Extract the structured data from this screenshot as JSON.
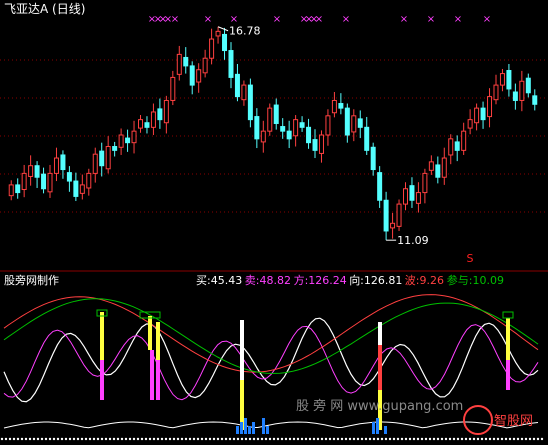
{
  "upper": {
    "title": "飞亚达A (日线)",
    "high_label": "16.78",
    "low_label": "11.09",
    "s_marker": "S",
    "x_marker": "×",
    "colors": {
      "up": "#ff4040",
      "down": "#54ffff",
      "title": "#ffffff",
      "marker": "#ff40ff",
      "grid": "#8a0000",
      "s_marker": "#ff2020"
    }
  },
  "lower": {
    "indicator_name": "股旁网制作",
    "readouts": [
      {
        "label": "买",
        "value": "45.43",
        "color": "#ffffff"
      },
      {
        "label": "卖",
        "value": "48.82",
        "color": "#ff40ff"
      },
      {
        "label": "方",
        "value": "126.24",
        "color": "#ff40ff"
      },
      {
        "label": "向",
        "value": "126.81",
        "color": "#ffffff"
      },
      {
        "label": "波",
        "value": "9.26",
        "color": "#ff4040"
      },
      {
        "label": "参与",
        "value": "10.09",
        "color": "#00c000"
      }
    ],
    "colors": {
      "white": "#ffffff",
      "magenta": "#ff40ff",
      "red": "#ff4040",
      "green": "#00c000",
      "yellow": "#ffff40",
      "blue": "#2080ff",
      "divider": "#8a0000"
    }
  },
  "watermark": {
    "text": "股 旁 网   www.gupang.com",
    "logo_text": "智股网"
  },
  "chart_data": [
    {
      "type": "candlestick",
      "title": "飞亚达A (日线)",
      "annotations": [
        {
          "text": "16.78",
          "kind": "period-high"
        },
        {
          "text": "11.09",
          "kind": "period-low"
        }
      ],
      "close_series_approx": [
        12.6,
        12.4,
        12.9,
        13.1,
        12.8,
        12.5,
        12.9,
        13.3,
        13.0,
        12.7,
        12.3,
        12.6,
        12.9,
        13.4,
        13.1,
        13.6,
        13.5,
        13.9,
        13.7,
        14.0,
        14.3,
        14.1,
        14.5,
        14.3,
        14.8,
        15.4,
        16.0,
        15.7,
        15.2,
        15.6,
        15.9,
        16.4,
        16.6,
        16.1,
        15.4,
        14.9,
        15.2,
        14.3,
        13.8,
        14.0,
        14.6,
        14.2,
        14.0,
        13.8,
        14.3,
        14.1,
        13.7,
        13.5,
        13.9,
        14.4,
        14.8,
        14.6,
        13.9,
        14.4,
        14.1,
        13.5,
        13.0,
        12.2,
        11.4,
        11.6,
        12.1,
        12.5,
        12.2,
        12.4,
        12.9,
        13.2,
        12.8,
        13.3,
        13.8,
        13.5,
        14.0,
        14.3,
        14.6,
        14.3,
        14.9,
        15.2,
        15.5,
        15.1,
        14.8,
        15.3,
        15.0,
        14.7
      ]
    },
    {
      "type": "line",
      "title": "股旁网制作",
      "series": [
        {
          "name": "买",
          "last_value": 45.43
        },
        {
          "name": "卖",
          "last_value": 48.82
        },
        {
          "name": "方",
          "last_value": 126.24
        },
        {
          "name": "向",
          "last_value": 126.81
        },
        {
          "name": "波",
          "last_value": 9.26
        },
        {
          "name": "参与",
          "last_value": 10.09
        }
      ]
    }
  ]
}
